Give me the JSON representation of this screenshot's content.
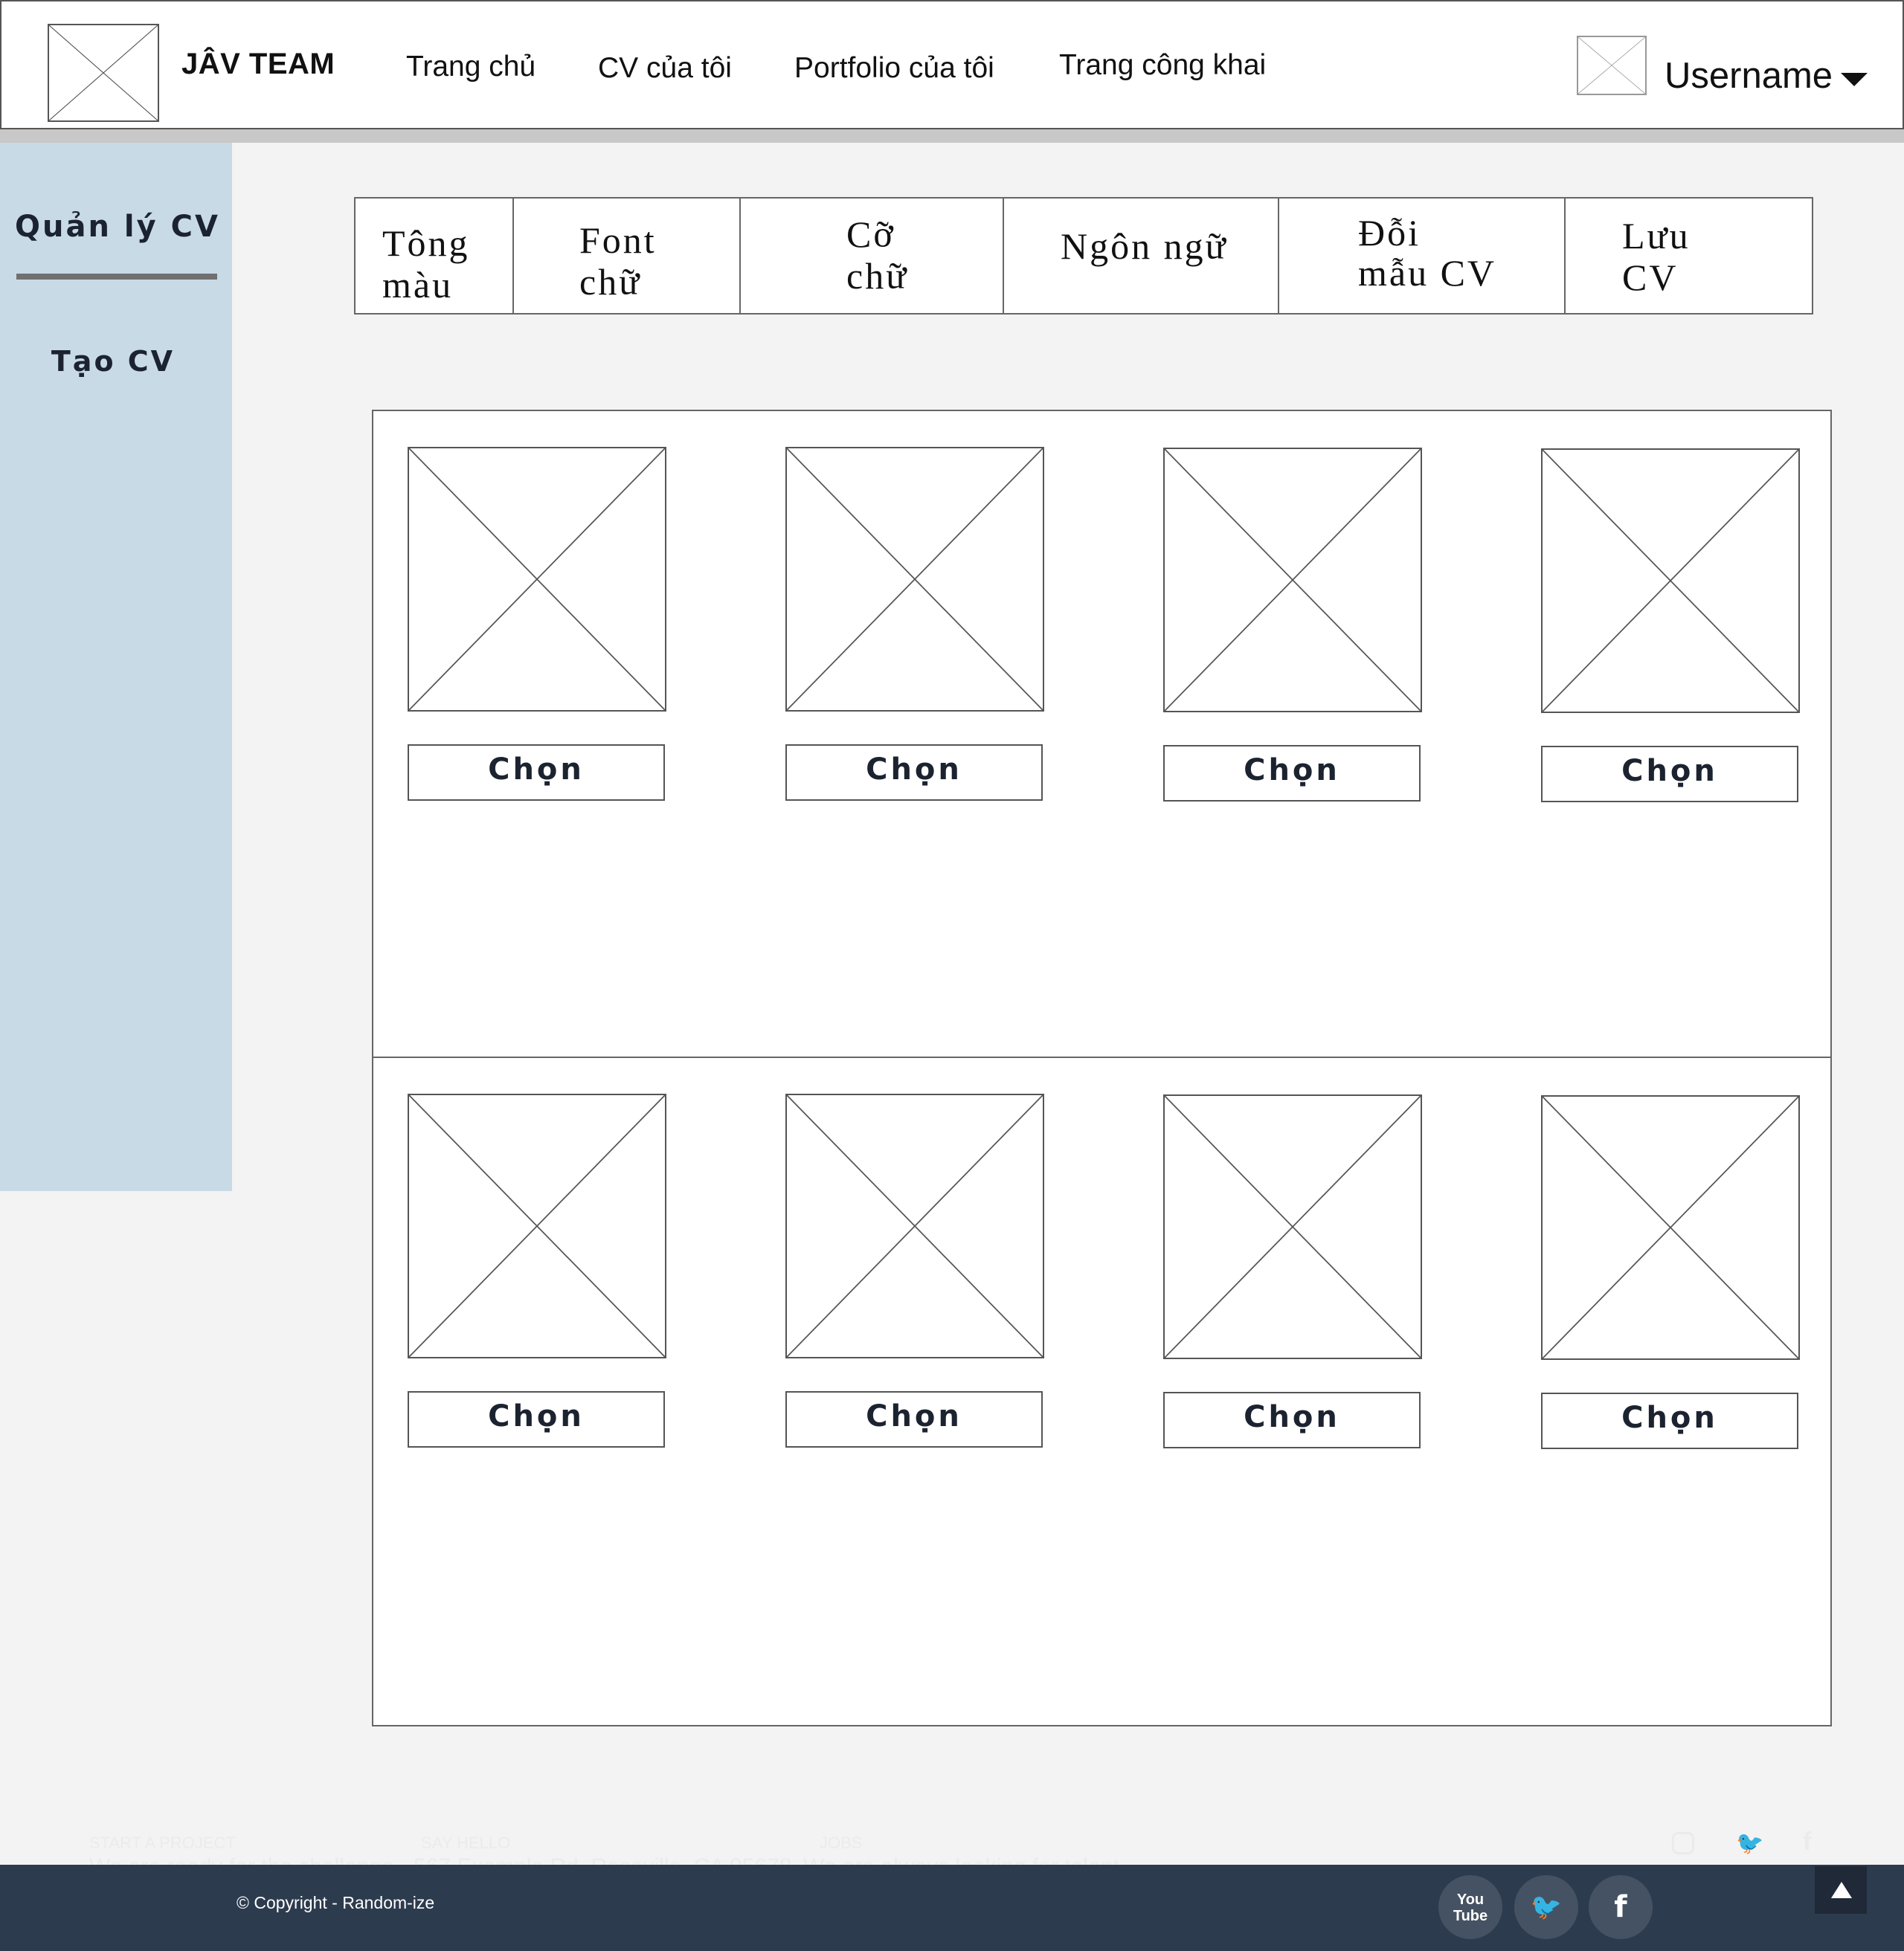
{
  "header": {
    "brand": "JÂV TEAM",
    "nav": [
      "Trang chủ",
      "CV của tôi",
      "Portfolio của tôi",
      "Trang công khai"
    ],
    "username": "Username"
  },
  "sidebar": {
    "items": [
      {
        "label": "Quản lý CV",
        "active": true
      },
      {
        "label": "Tạo CV",
        "active": false
      }
    ]
  },
  "toolbar": {
    "items": [
      {
        "line1": "Tông",
        "line2": "màu"
      },
      {
        "line1": "Font",
        "line2": "chữ"
      },
      {
        "line1": "Cỡ",
        "line2": "chữ"
      },
      {
        "line1": "Ngôn ngữ",
        "line2": ""
      },
      {
        "line1": "Đỗi",
        "line2": "mẫu CV"
      },
      {
        "line1": "Lưu",
        "line2": "CV"
      }
    ]
  },
  "templates": {
    "choose_label": "Chọn",
    "rows": 2,
    "per_row": 4
  },
  "footer": {
    "ghost": {
      "col1_title": "START A PROJECT",
      "col1_text": "We are ready for the challenge",
      "col2_title": "SAY HELLO",
      "col2_text": "567 Example Rd, Roseville, CA 95678",
      "col3_title": "JOBS",
      "col3_text": "We are always looking for talent"
    },
    "copyright": "© Copyright - Random-ize",
    "social": [
      {
        "icon": "youtube-icon",
        "glyph": "You Tube"
      },
      {
        "icon": "twitter-icon",
        "glyph": "🐦"
      },
      {
        "icon": "facebook-icon",
        "glyph": "f"
      }
    ],
    "colors": {
      "bar": "#2d3b4e",
      "circle": "#455263"
    }
  }
}
